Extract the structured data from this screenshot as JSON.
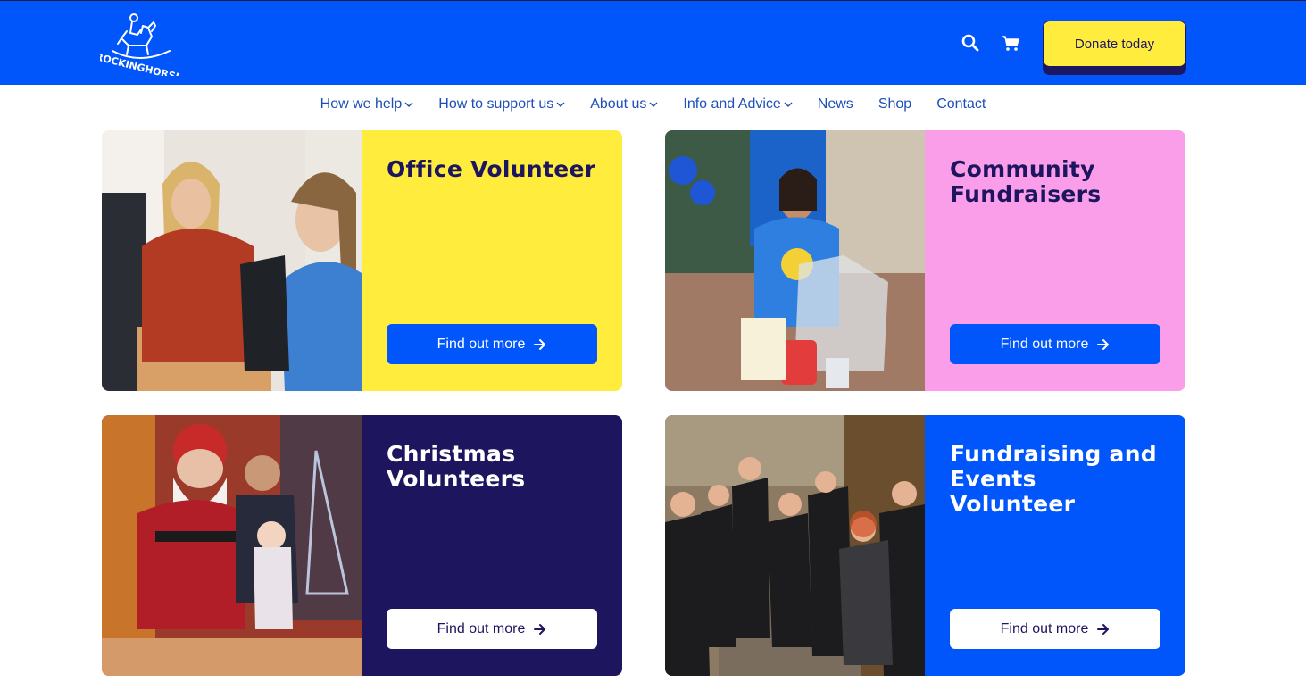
{
  "header": {
    "logo_text": "ROCKINGHORSE",
    "search_icon": "search-icon",
    "cart_icon": "cart-icon",
    "donate_label": "Donate today",
    "colors": {
      "header_bg": "#0055fb",
      "donate_bg": "#ffec3d",
      "donate_text": "#1b1763"
    }
  },
  "nav": {
    "items": [
      {
        "label": "How we help",
        "has_dropdown": true
      },
      {
        "label": "How to support us",
        "has_dropdown": true
      },
      {
        "label": "About us",
        "has_dropdown": true
      },
      {
        "label": "Info and Advice",
        "has_dropdown": true
      },
      {
        "label": "News",
        "has_dropdown": false
      },
      {
        "label": "Shop",
        "has_dropdown": false
      },
      {
        "label": "Contact",
        "has_dropdown": false
      }
    ]
  },
  "cards": [
    {
      "title_lines": [
        "Office Volunteer"
      ],
      "cta": "Find out more",
      "panel_color": "#ffec3d",
      "photo": "office-volunteers-photo"
    },
    {
      "title_lines": [
        "Community",
        "Fundraisers"
      ],
      "cta": "Find out more",
      "panel_color": "#fb9ee9",
      "photo": "community-fundraiser-photo"
    },
    {
      "title_lines": [
        "Christmas",
        "Volunteers"
      ],
      "cta": "Find out more",
      "panel_color": "#1d165f",
      "photo": "christmas-volunteers-photo"
    },
    {
      "title_lines": [
        "Fundraising and",
        "Events",
        "Volunteer"
      ],
      "cta": "Find out more",
      "panel_color": "#0055fb",
      "photo": "events-volunteers-photo"
    }
  ]
}
